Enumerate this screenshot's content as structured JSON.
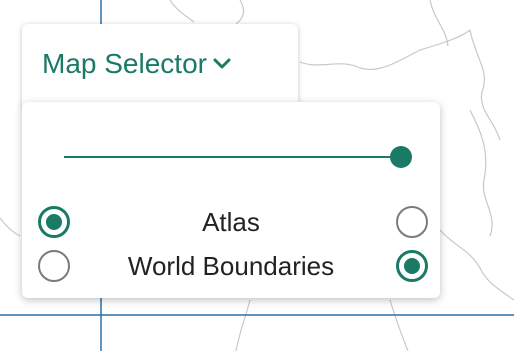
{
  "selector": {
    "title": "Map Selector",
    "chevron_icon": "chevron-down-icon",
    "accent_color": "#1a7a66"
  },
  "opacity_slider": {
    "value_fraction": 1.0
  },
  "layers": [
    {
      "label": "Atlas",
      "left_selected": true,
      "right_selected": false
    },
    {
      "label": "World Boundaries",
      "left_selected": false,
      "right_selected": true
    }
  ]
}
